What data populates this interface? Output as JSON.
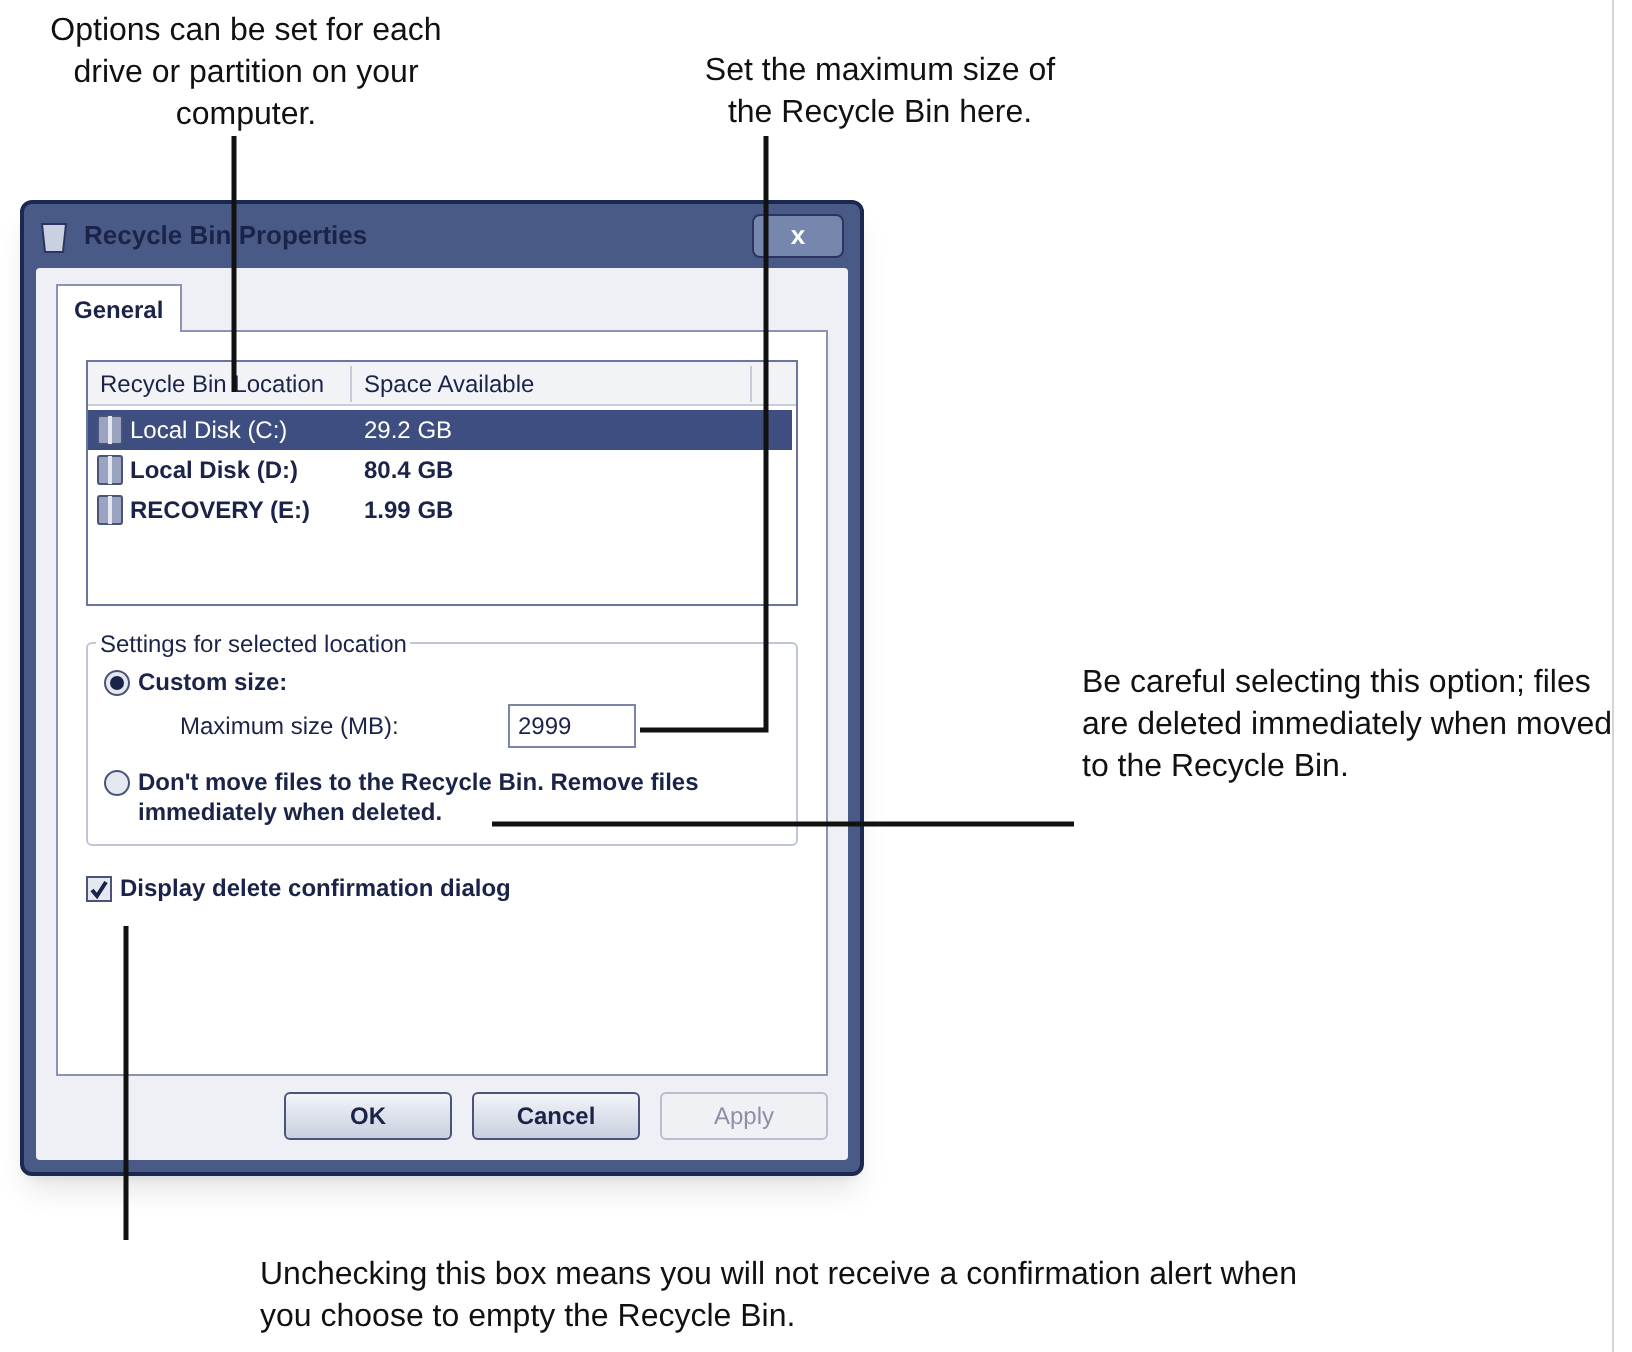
{
  "callouts": [
    {
      "kind": "top-left",
      "text": "Options can be set for each drive or partition on your computer."
    },
    {
      "kind": "top",
      "text": "Set the maximum size of the Recycle Bin here."
    },
    {
      "kind": "right",
      "text": "Be careful selecting this option; files are deleted immediately when moved to the Recycle Bin."
    },
    {
      "kind": "bottom",
      "text": "Unchecking this box means you will not receive a confirmation alert when you choose to empty the Recycle Bin."
    }
  ],
  "dialog": {
    "title": "Recycle Bin Properties",
    "close": "x",
    "tabs": [
      {
        "label": "General",
        "selected": true
      }
    ],
    "table": {
      "columns": [
        "Recycle Bin Location",
        "Space Available"
      ],
      "rows": [
        {
          "location": "Local Disk (C:)",
          "space": "29.2 GB",
          "selected": true
        },
        {
          "location": "Local Disk (D:)",
          "space": "80.4 GB",
          "selected": false
        },
        {
          "location": "RECOVERY (E:)",
          "space": "1.99 GB",
          "selected": false
        }
      ]
    },
    "group": {
      "title": "Settings for selected location",
      "options": [
        {
          "label": "Custom size:",
          "selected": true
        },
        {
          "label": "Don't move files to the Recycle Bin. Remove files immediately when deleted.",
          "selected": false
        }
      ],
      "size_label": "Maximum size (MB):",
      "size_value": "2999"
    },
    "checkbox": {
      "label": "Display delete confirmation dialog",
      "checked": true
    },
    "buttons": [
      {
        "label": "OK",
        "disabled": false
      },
      {
        "label": "Cancel",
        "disabled": false
      },
      {
        "label": "Apply",
        "disabled": true
      }
    ]
  }
}
